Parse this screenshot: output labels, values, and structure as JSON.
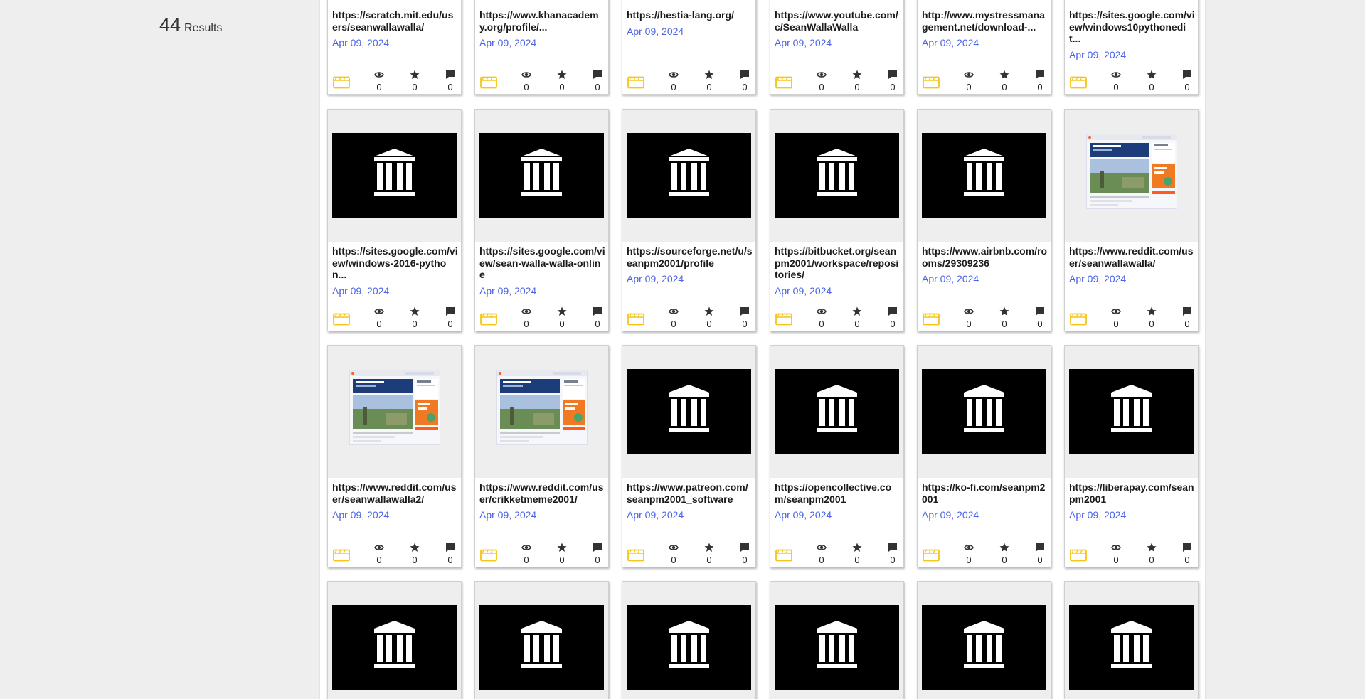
{
  "results": {
    "count": "44",
    "label": "Results"
  },
  "rows": [
    {
      "cards": [
        {
          "title": "https://scratch.mit.edu/users/seanwallawalla/",
          "date": "Apr 09, 2024",
          "views": "0",
          "favorites": "0",
          "reviews": "0"
        },
        {
          "title": "https://www.khanacademy.org/profile/...",
          "date": "Apr 09, 2024",
          "views": "0",
          "favorites": "0",
          "reviews": "0"
        },
        {
          "title": "https://hestia-lang.org/",
          "date": "Apr 09, 2024",
          "views": "0",
          "favorites": "0",
          "reviews": "0"
        },
        {
          "title": "https://www.youtube.com/c/SeanWallaWalla",
          "date": "Apr 09, 2024",
          "views": "0",
          "favorites": "0",
          "reviews": "0"
        },
        {
          "title": "http://www.mystressmanagement.net/download-...",
          "date": "Apr 09, 2024",
          "views": "0",
          "favorites": "0",
          "reviews": "0"
        },
        {
          "title": "https://sites.google.com/view/windows10pythonedit...",
          "date": "Apr 09, 2024",
          "views": "0",
          "favorites": "0",
          "reviews": "0"
        }
      ]
    },
    {
      "cards": [
        {
          "title": "https://sites.google.com/view/windows-2016-python...",
          "date": "Apr 09, 2024",
          "views": "0",
          "favorites": "0",
          "reviews": "0",
          "thumb": "archive-logo"
        },
        {
          "title": "https://sites.google.com/view/sean-walla-walla-online",
          "date": "Apr 09, 2024",
          "views": "0",
          "favorites": "0",
          "reviews": "0",
          "thumb": "archive-logo"
        },
        {
          "title": "https://sourceforge.net/u/seanpm2001/profile",
          "date": "Apr 09, 2024",
          "views": "0",
          "favorites": "0",
          "reviews": "0",
          "thumb": "archive-logo"
        },
        {
          "title": "https://bitbucket.org/seanpm2001/workspace/repositories/",
          "date": "Apr 09, 2024",
          "views": "0",
          "favorites": "0",
          "reviews": "0",
          "thumb": "archive-logo"
        },
        {
          "title": "https://www.airbnb.com/rooms/29309236",
          "date": "Apr 09, 2024",
          "views": "0",
          "favorites": "0",
          "reviews": "0",
          "thumb": "archive-logo"
        },
        {
          "title": "https://www.reddit.com/user/seanwallawalla/",
          "date": "Apr 09, 2024",
          "views": "0",
          "favorites": "0",
          "reviews": "0",
          "thumb": "page-screenshot"
        }
      ]
    },
    {
      "cards": [
        {
          "title": "https://www.reddit.com/user/seanwallawalla2/",
          "date": "Apr 09, 2024",
          "views": "0",
          "favorites": "0",
          "reviews": "0",
          "thumb": "page-screenshot"
        },
        {
          "title": "https://www.reddit.com/user/crikketmeme2001/",
          "date": "Apr 09, 2024",
          "views": "0",
          "favorites": "0",
          "reviews": "0",
          "thumb": "page-screenshot"
        },
        {
          "title": "https://www.patreon.com/seanpm2001_software",
          "date": "Apr 09, 2024",
          "views": "0",
          "favorites": "0",
          "reviews": "0",
          "thumb": "archive-logo"
        },
        {
          "title": "https://opencollective.com/seanpm2001",
          "date": "Apr 09, 2024",
          "views": "0",
          "favorites": "0",
          "reviews": "0",
          "thumb": "archive-logo"
        },
        {
          "title": "https://ko-fi.com/seanpm2001",
          "date": "Apr 09, 2024",
          "views": "0",
          "favorites": "0",
          "reviews": "0",
          "thumb": "archive-logo"
        },
        {
          "title": "https://liberapay.com/seanpm2001",
          "date": "Apr 09, 2024",
          "views": "0",
          "favorites": "0",
          "reviews": "0",
          "thumb": "archive-logo"
        }
      ]
    },
    {
      "cards": [
        {
          "thumb": "archive-logo"
        },
        {
          "thumb": "archive-logo"
        },
        {
          "thumb": "archive-logo"
        },
        {
          "thumb": "archive-logo"
        },
        {
          "thumb": "archive-logo"
        },
        {
          "thumb": "archive-logo"
        }
      ]
    }
  ],
  "colors": {
    "date": "#4a63e8",
    "collection_icon": "#f5c518",
    "text": "#1b1b1b"
  }
}
